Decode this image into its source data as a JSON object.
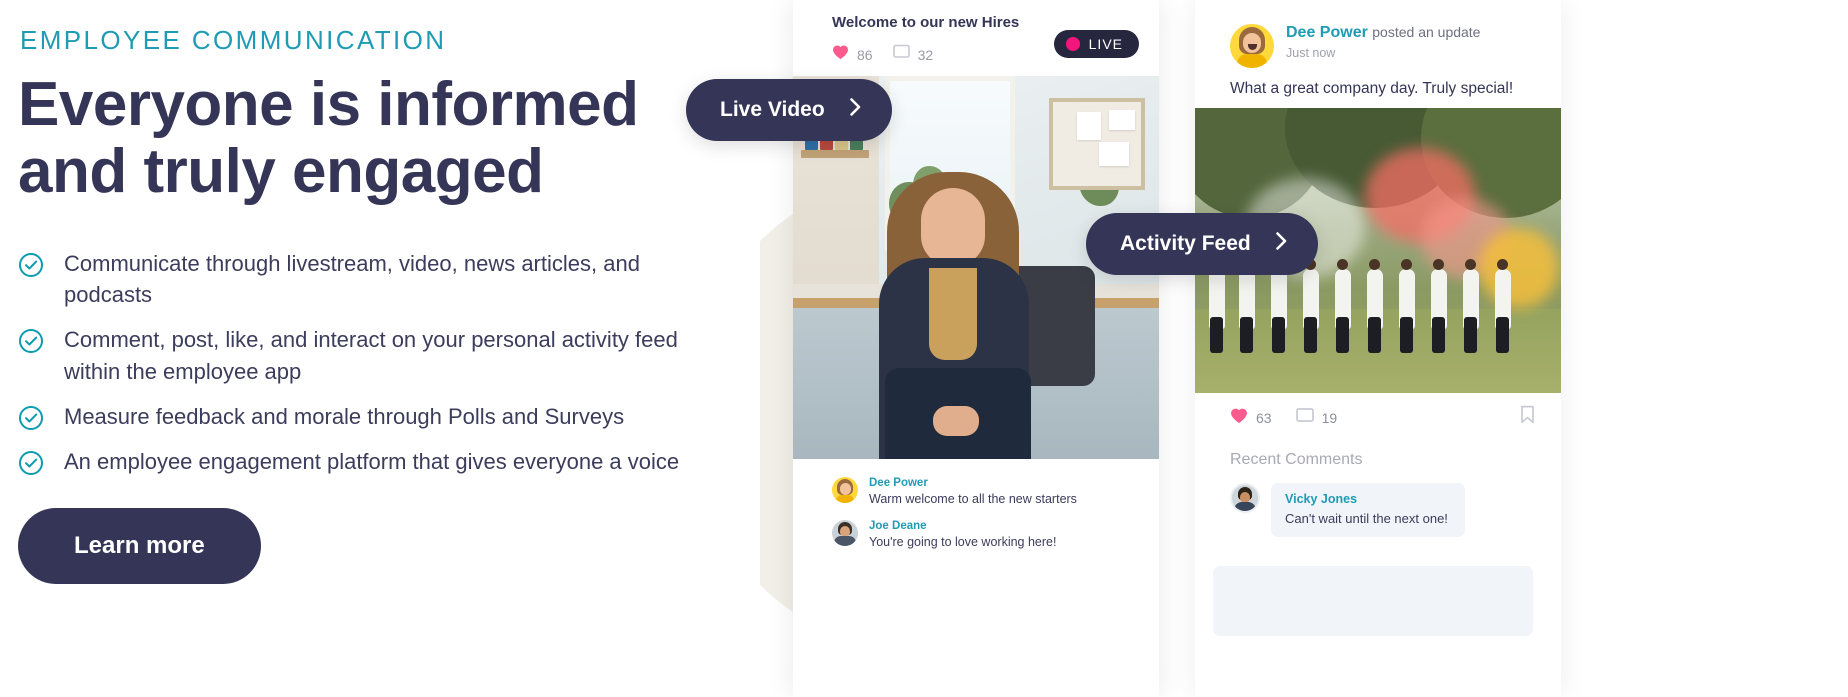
{
  "hero": {
    "eyebrow": "EMPLOYEE COMMUNICATION",
    "headline_line1": "Everyone is informed",
    "headline_line2": "and truly engaged",
    "bullets": [
      "Communicate through livestream, video, news articles, and podcasts",
      "Comment, post, like, and interact on your personal activity feed within the employee app",
      "Measure feedback and morale through Polls and Surveys",
      "An employee engagement platform that gives everyone a voice"
    ],
    "cta_label": "Learn more"
  },
  "callouts": {
    "live_video": "Live Video",
    "activity_feed": "Activity Feed",
    "chevron": "›"
  },
  "stream_card": {
    "title": "Welcome to our new Hires",
    "likes": "86",
    "comments": "32",
    "live_badge": "LIVE",
    "comment_list": [
      {
        "name": "Dee Power",
        "text": "Warm welcome to all the new starters"
      },
      {
        "name": "Joe Deane",
        "text": "You're going to love working here!"
      }
    ]
  },
  "feed_card": {
    "author": "Dee Power",
    "verb": "posted an update",
    "time": "Just now",
    "post_text": "What a great company day. Truly special!",
    "likes": "63",
    "comments": "19",
    "recent_label": "Recent Comments",
    "comment_list": [
      {
        "name": "Vicky Jones",
        "text": "Can't wait until the next one!"
      }
    ]
  },
  "colors": {
    "teal": "#1f9cb4",
    "navy": "#353557",
    "pink": "#f5147b",
    "heart": "#fc5c8d",
    "blob": "#f2efe9"
  }
}
